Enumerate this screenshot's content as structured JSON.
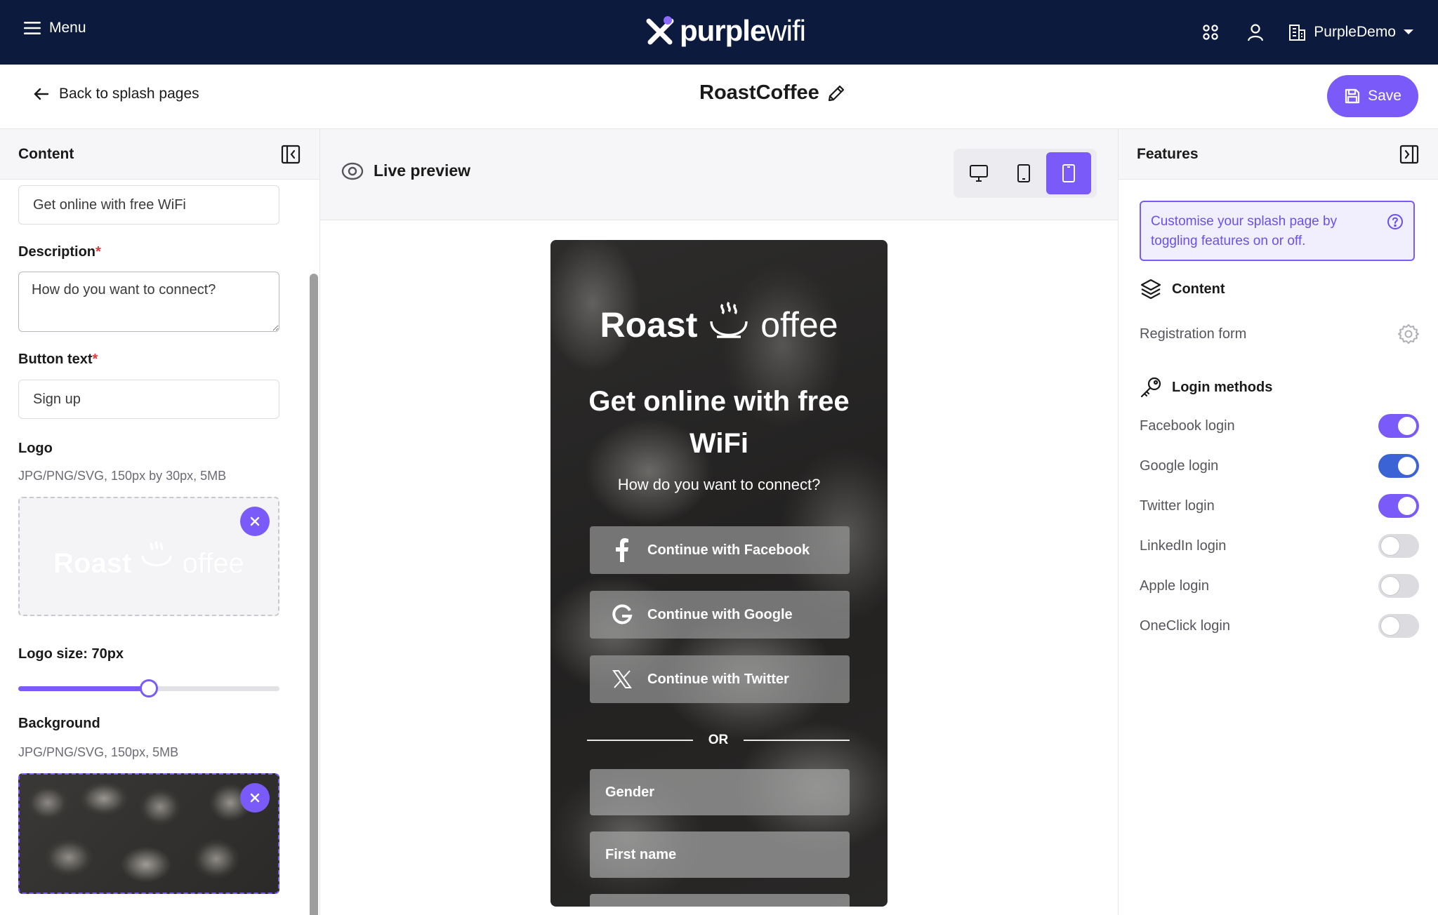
{
  "topnav": {
    "menu_label": "Menu",
    "brand_bold": "purple",
    "brand_light": "wifi",
    "account_label": "PurpleDemo"
  },
  "subheader": {
    "back_label": "Back to splash pages",
    "page_title": "RoastCoffee",
    "save_label": "Save"
  },
  "content_panel": {
    "title": "Content",
    "heading_value": "Get online with free WiFi",
    "description_label": "Description",
    "description_value": "How do you want to connect?",
    "button_text_label": "Button text",
    "button_text_value": "Sign up",
    "logo_label": "Logo",
    "logo_hint": "JPG/PNG/SVG, 150px by 30px, 5MB",
    "logo_size_label": "Logo size: 70px",
    "logo_size_fraction": 0.5,
    "background_label": "Background",
    "background_hint": "JPG/PNG/SVG, 150px, 5MB",
    "required_mark": "*"
  },
  "preview": {
    "title": "Live preview",
    "devices": [
      "desktop",
      "tablet",
      "mobile"
    ],
    "active_device": "mobile",
    "logo_bold": "Roast",
    "logo_light": "offee",
    "headline": "Get online with free WiFi",
    "description": "How do you want to connect?",
    "buttons": [
      {
        "label": "Continue with Facebook",
        "icon": "facebook-icon"
      },
      {
        "label": "Continue with Google",
        "icon": "google-icon"
      },
      {
        "label": "Continue with Twitter",
        "icon": "x-twitter-icon"
      }
    ],
    "or_label": "OR",
    "fields": [
      "Gender",
      "First name"
    ]
  },
  "features_panel": {
    "title": "Features",
    "info_text": "Customise your splash page by toggling features on or off.",
    "content_section": "Content",
    "registration_form": "Registration form",
    "login_section": "Login methods",
    "logins": [
      {
        "label": "Facebook login",
        "on": true
      },
      {
        "label": "Google login",
        "on": true
      },
      {
        "label": "Twitter login",
        "on": true
      },
      {
        "label": "LinkedIn login",
        "on": false
      },
      {
        "label": "Apple login",
        "on": false
      },
      {
        "label": "OneClick login",
        "on": false
      }
    ]
  },
  "colors": {
    "nav_bg": "#0c1a3d",
    "accent": "#7a5af8",
    "google_toggle": "#3b63d6"
  }
}
